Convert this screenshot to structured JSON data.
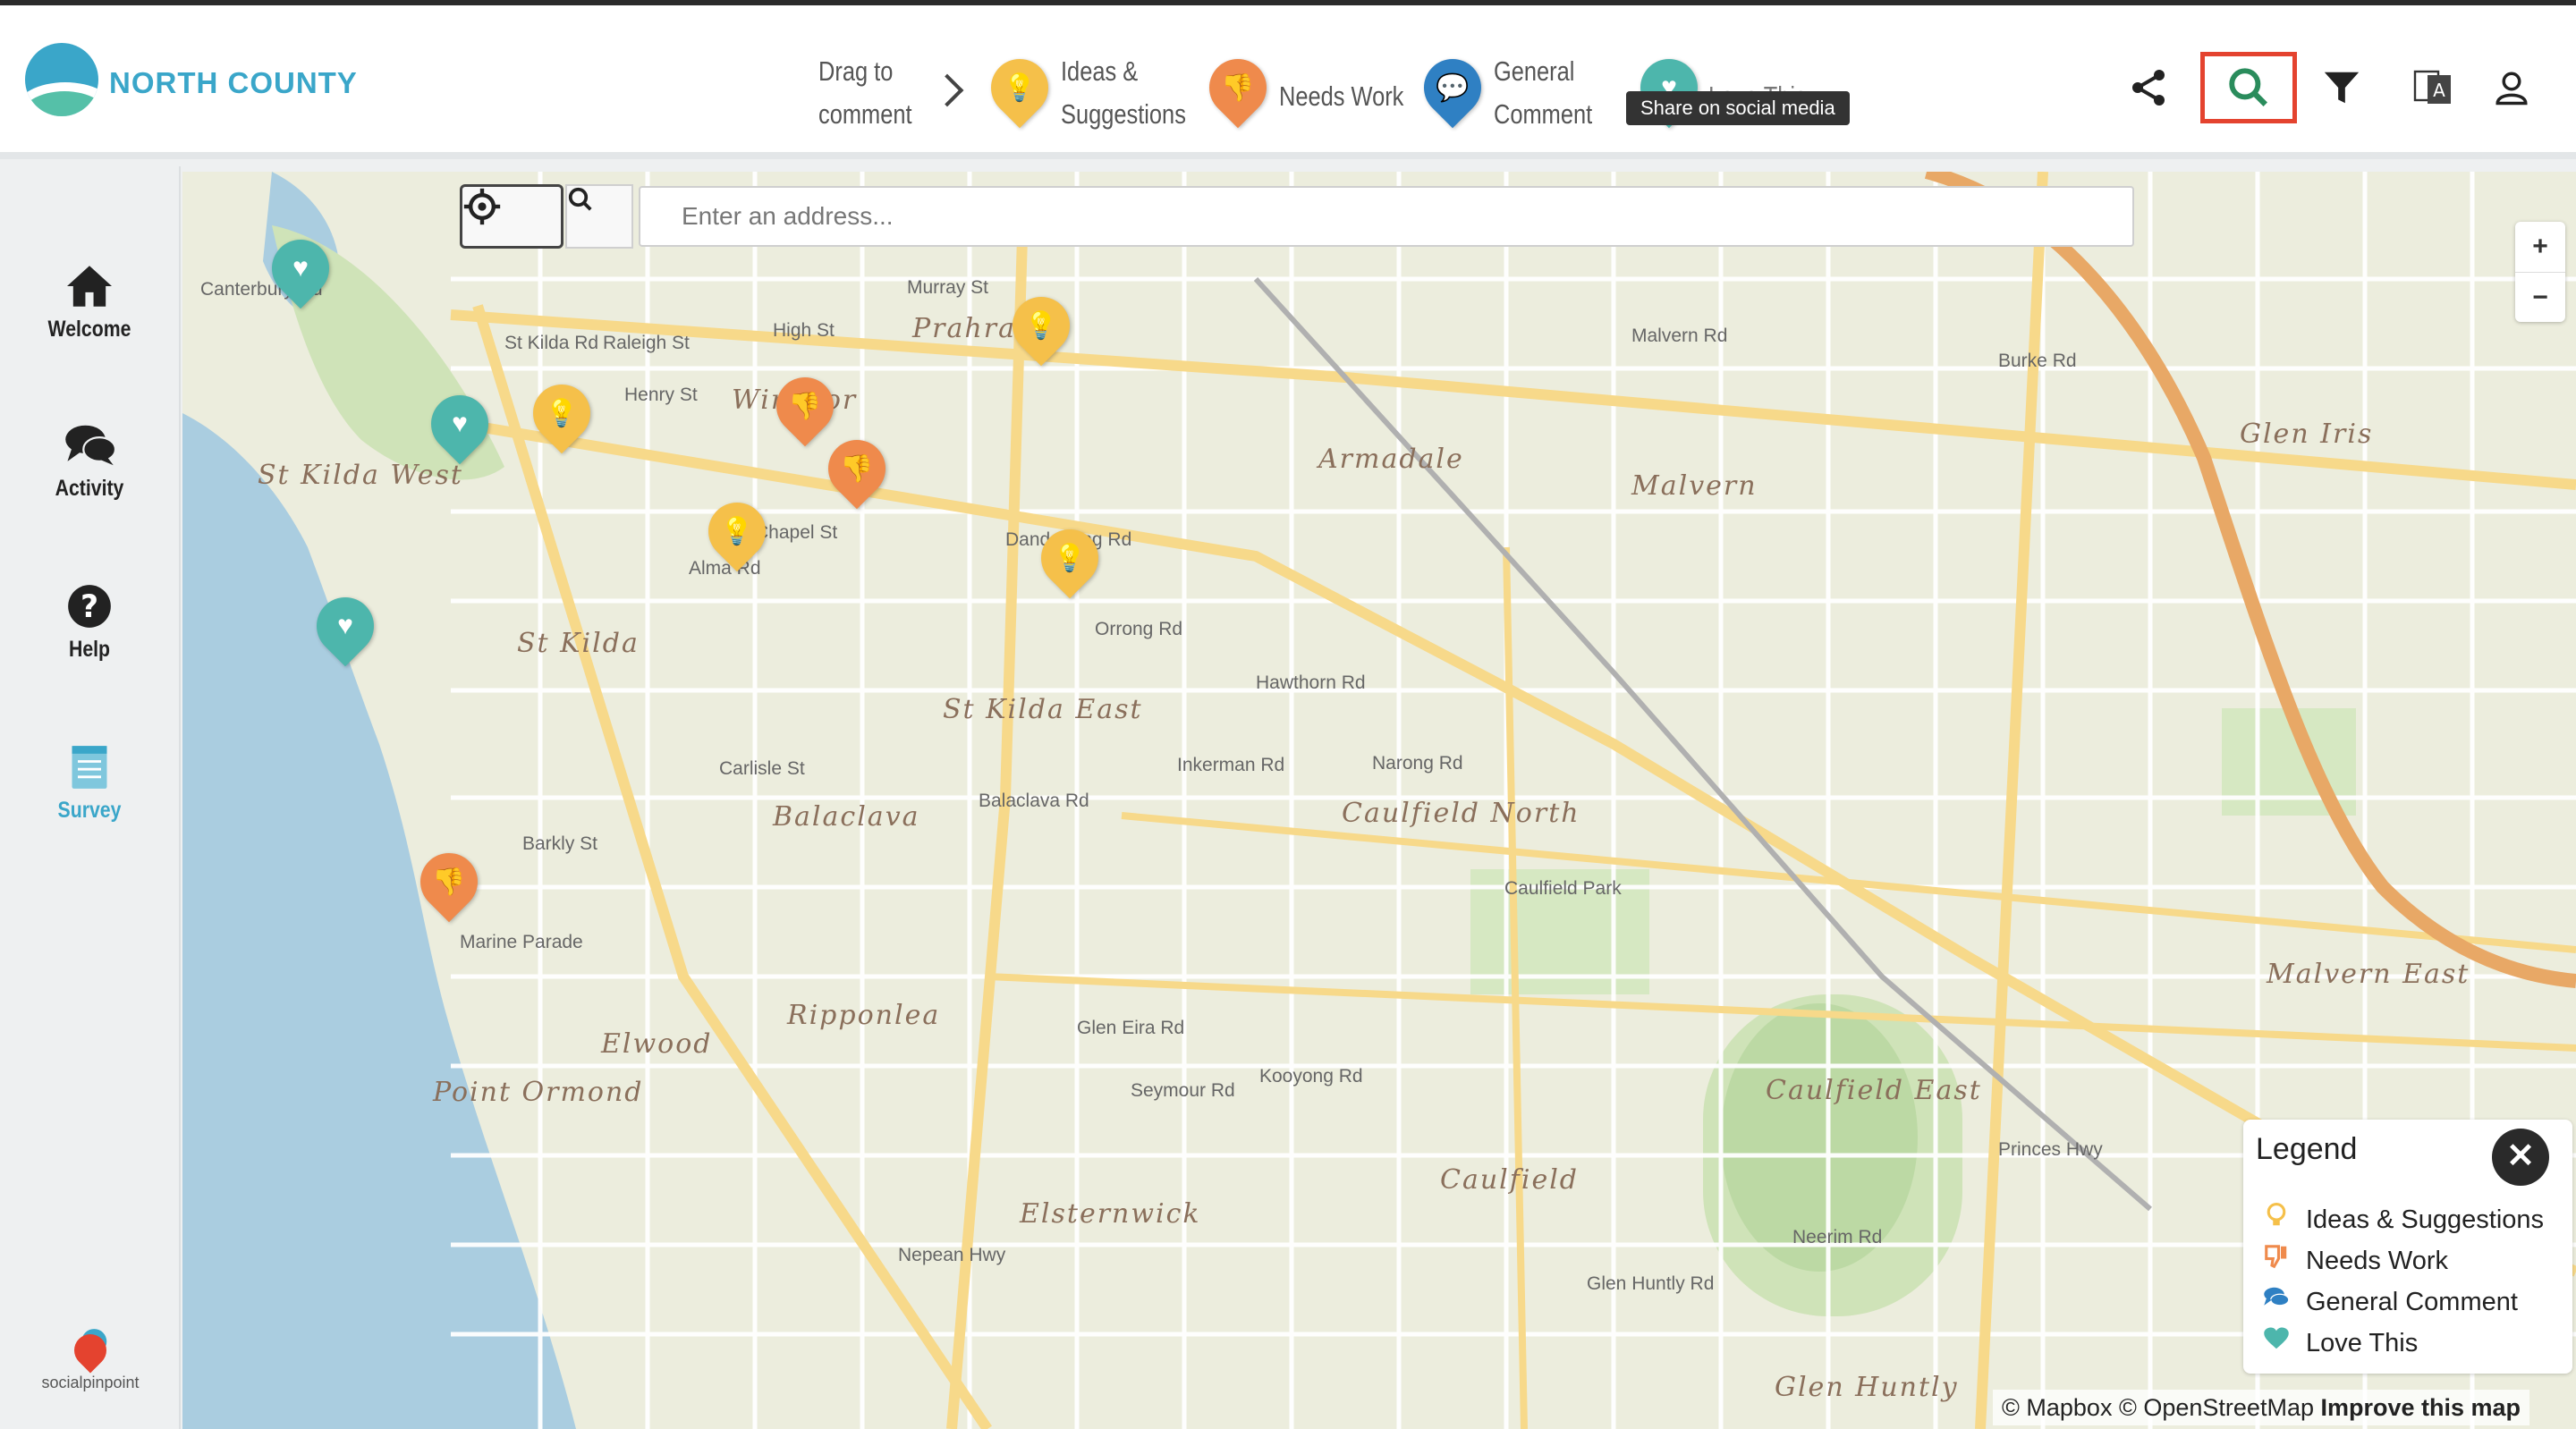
{
  "header": {
    "logo_text": "NORTH COUNTY",
    "drag_line1": "Drag to",
    "drag_line2": "comment",
    "ideas_line1": "Ideas &",
    "ideas_line2": "Suggestions",
    "needs_label": "Needs Work",
    "general_line1": "General",
    "general_line2": "Comment",
    "love_label": "Love This",
    "tooltip": "Share on social media"
  },
  "sidebar": {
    "items": [
      {
        "label": "Welcome",
        "icon": "home-icon"
      },
      {
        "label": "Activity",
        "icon": "chat-icon"
      },
      {
        "label": "Help",
        "icon": "question-icon"
      },
      {
        "label": "Survey",
        "icon": "survey-icon"
      }
    ],
    "brand": "socialpinpoint"
  },
  "map": {
    "search_placeholder": "Enter an address...",
    "zoom_in": "+",
    "zoom_out": "−",
    "suburbs": [
      "St Kilda West",
      "St Kilda",
      "Prahran",
      "Windsor",
      "Armadale",
      "Malvern",
      "Glen Iris",
      "St Kilda East",
      "Balaclava",
      "Caulfield North",
      "Caulfield East",
      "Caulfield",
      "Elwood",
      "Ripponlea",
      "Elsternwick",
      "Point Ormond",
      "Malvern East",
      "Glen Huntly",
      "Caulfield Park"
    ],
    "roads": [
      "High St",
      "Dandenong Rd",
      "Alma Rd",
      "Inkerman Rd",
      "Glen Eira Rd",
      "Princes Hwy",
      "Nepean Hwy",
      "Marine Parade",
      "St Kilda Rd",
      "Carlisle St",
      "Balaclava Rd",
      "Burke Rd",
      "Malvern Rd",
      "Kooyong Rd",
      "Orrong Rd",
      "Hawthorn Rd",
      "Neerim Rd",
      "Glen Huntly Rd",
      "Seymour Rd",
      "Narong Rd",
      "Murray St",
      "Raleigh St",
      "Henry St",
      "Canterbury Rd",
      "Barkly St",
      "Chapel St"
    ],
    "pins": [
      {
        "type": "love"
      },
      {
        "type": "love"
      },
      {
        "type": "love"
      },
      {
        "type": "ideas"
      },
      {
        "type": "ideas"
      },
      {
        "type": "ideas"
      },
      {
        "type": "ideas"
      },
      {
        "type": "needs"
      },
      {
        "type": "needs"
      },
      {
        "type": "needs"
      }
    ]
  },
  "legend": {
    "title": "Legend",
    "items": [
      {
        "label": "Ideas & Suggestions",
        "color": "#f5c04a"
      },
      {
        "label": "Needs Work",
        "color": "#ef8a4c"
      },
      {
        "label": "General Comment",
        "color": "#2f80c3"
      },
      {
        "label": "Love This",
        "color": "#4db6ac"
      }
    ]
  },
  "attribution": {
    "mapbox": "© Mapbox",
    "osm": "© OpenStreetMap",
    "improve": "Improve this map"
  },
  "colors": {
    "brand": "#3aa6c9",
    "highlight": "#e4432f"
  }
}
